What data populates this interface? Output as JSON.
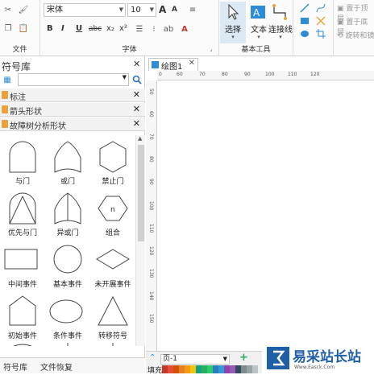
{
  "ribbon": {
    "file_group_label": "文件",
    "font_group_label": "字体",
    "tools_group_label": "基本工具",
    "font_name": "宋体",
    "font_size": "10",
    "grow_font": "A",
    "shrink_font": "A",
    "format_buttons": [
      "B",
      "I",
      "U",
      "abc",
      "x₂",
      "x²"
    ],
    "select_label": "选择",
    "text_label": "文本",
    "connector_label": "连接线",
    "bring_to_top": "置于顶层",
    "send_to_bottom": "置于底层",
    "rotate_flip": "旋转和镜像"
  },
  "panel": {
    "title": "符号库",
    "categories": [
      "标注",
      "箭头形状",
      "故障树分析形状"
    ],
    "shapes": [
      {
        "label": "与门",
        "icon": "and-gate-icon"
      },
      {
        "label": "或门",
        "icon": "or-gate-icon"
      },
      {
        "label": "禁止门",
        "icon": "inhibit-gate-icon"
      },
      {
        "label": "优先与门",
        "icon": "priority-and-gate-icon"
      },
      {
        "label": "异或门",
        "icon": "xor-gate-icon"
      },
      {
        "label": "组合",
        "icon": "combination-icon",
        "inner": "n"
      },
      {
        "label": "中间事件",
        "icon": "intermediate-event-icon"
      },
      {
        "label": "基本事件",
        "icon": "basic-event-icon"
      },
      {
        "label": "未开展事件",
        "icon": "undeveloped-event-icon"
      },
      {
        "label": "初始事件",
        "icon": "initial-event-icon"
      },
      {
        "label": "条件事件",
        "icon": "conditional-event-icon"
      },
      {
        "label": "转移符号",
        "icon": "transfer-symbol-icon"
      }
    ],
    "bottom_tabs": [
      "符号库",
      "文件恢复"
    ]
  },
  "document": {
    "tab_label": "绘图1",
    "h_ruler": [
      "0",
      "60",
      "70",
      "80",
      "90",
      "100",
      "110",
      "120"
    ],
    "v_ruler": [
      "50",
      "60",
      "70",
      "80",
      "90",
      "100",
      "110",
      "120",
      "130",
      "140",
      "150"
    ],
    "page_label": "页-1",
    "fill_label": "填充"
  },
  "colors": {
    "accent": "#2e8bd8",
    "palette": [
      "#c0392b",
      "#e74c3c",
      "#d35400",
      "#e67e22",
      "#f39c12",
      "#f1c40f",
      "#16a085",
      "#27ae60",
      "#2ecc71",
      "#2980b9",
      "#3498db",
      "#8e44ad",
      "#9b59b6",
      "#34495e",
      "#7f8c8d",
      "#95a5a6",
      "#bdc3c7",
      "#ecf0f1",
      "#ff9999",
      "#ffcc99",
      "#ffff99",
      "#ccff99",
      "#99ffcc",
      "#99ccff",
      "#cc99ff",
      "#ff99cc",
      "#993333",
      "#996633",
      "#999933",
      "#669933",
      "#339966",
      "#336699",
      "#663399",
      "#993366"
    ]
  },
  "watermark": {
    "text": "易采站长站",
    "sub": "Www.Easck.Com"
  }
}
